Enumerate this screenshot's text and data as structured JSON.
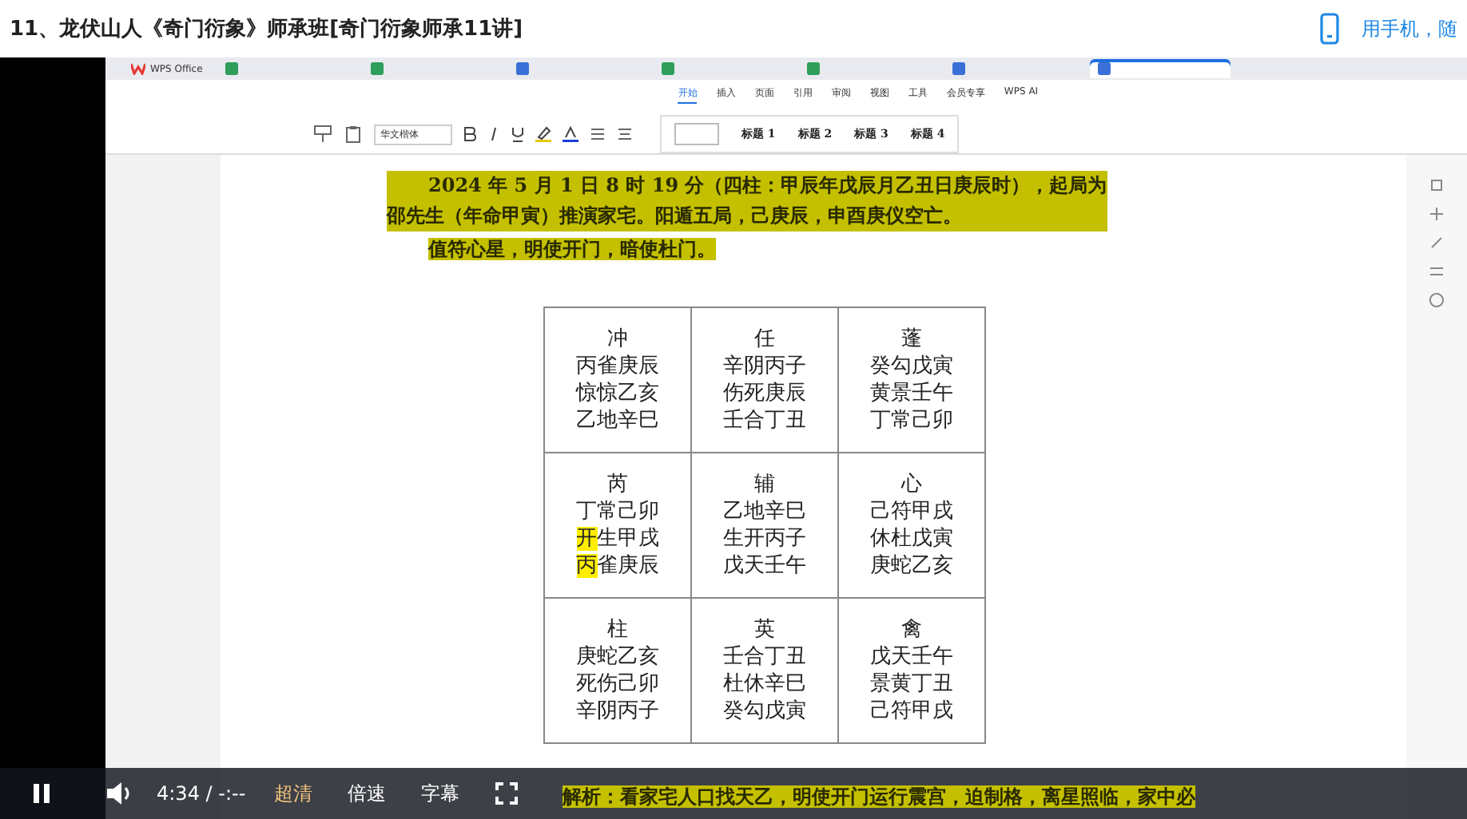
{
  "header": {
    "title": "11、龙伏山人《奇门衍象》师承班[奇门衍象师承11讲]",
    "phone_link": "用手机，随"
  },
  "app": {
    "brand": "WPS Office",
    "doc_tabs": [
      {
        "color": "#2e9e5a",
        "selected": false
      },
      {
        "color": "#2e9e5a",
        "selected": false
      },
      {
        "color": "#3b6fd8",
        "selected": false
      },
      {
        "color": "#2e9e5a",
        "selected": false
      },
      {
        "color": "#2e9e5a",
        "selected": false
      },
      {
        "color": "#3b6fd8",
        "selected": false
      },
      {
        "color": "#3b6fd8",
        "selected": true
      }
    ],
    "menu": [
      {
        "label": "开始",
        "selected": true
      },
      {
        "label": "插入",
        "selected": false
      },
      {
        "label": "页面",
        "selected": false
      },
      {
        "label": "引用",
        "selected": false
      },
      {
        "label": "审阅",
        "selected": false
      },
      {
        "label": "视图",
        "selected": false
      },
      {
        "label": "工具",
        "selected": false
      },
      {
        "label": "会员专享",
        "selected": false
      },
      {
        "label": "WPS AI",
        "selected": false
      }
    ],
    "font_name": "华文楷体",
    "styles": [
      "标题 1",
      "标题 2",
      "标题 3",
      "标题 4"
    ]
  },
  "document": {
    "paragraph": [
      "2024 年 5 月 1 日 8 时 19 分（四柱：甲辰年戊辰月乙丑日庚辰时），起局为",
      "邵先生（年命甲寅）推演家宅。阳遁五局，己庚辰，申酉庚仪空亡。"
    ],
    "paragraph_2": "值符心星，明使开门，暗使杜门。",
    "grid": [
      {
        "star": "冲",
        "lines": [
          {
            "text": "丙雀庚辰"
          },
          {
            "text": "惊惊乙亥"
          },
          {
            "text": "乙地辛巳"
          }
        ]
      },
      {
        "star": "任",
        "lines": [
          {
            "text": "辛阴丙子"
          },
          {
            "text": "伤死庚辰"
          },
          {
            "text": "壬合丁丑"
          }
        ]
      },
      {
        "star": "蓬",
        "lines": [
          {
            "text": "癸勾戊寅"
          },
          {
            "text": "黄景壬午"
          },
          {
            "text": "丁常己卯"
          }
        ]
      },
      {
        "star": "芮",
        "lines": [
          {
            "text": "丁常己卯"
          },
          {
            "highlight": "开",
            "text": "生甲戌"
          },
          {
            "highlight": "丙",
            "text": "雀庚辰"
          }
        ]
      },
      {
        "star": "辅",
        "lines": [
          {
            "text": "乙地辛巳"
          },
          {
            "text": "生开丙子"
          },
          {
            "text": "戊天壬午"
          }
        ]
      },
      {
        "star": "心",
        "lines": [
          {
            "text": "己符甲戌"
          },
          {
            "text": "休杜戊寅"
          },
          {
            "text": "庚蛇乙亥"
          }
        ]
      },
      {
        "star": "柱",
        "lines": [
          {
            "text": "庚蛇乙亥"
          },
          {
            "text": "死伤己卯"
          },
          {
            "text": "辛阴丙子"
          }
        ]
      },
      {
        "star": "英",
        "lines": [
          {
            "text": "壬合丁丑"
          },
          {
            "text": "杜休辛巳"
          },
          {
            "text": "癸勾戊寅"
          }
        ]
      },
      {
        "star": "禽",
        "lines": [
          {
            "text": "戊天壬午"
          },
          {
            "text": "景黄丁丑"
          },
          {
            "text": "己符甲戌"
          }
        ]
      }
    ],
    "analysis": "解析：看家宅人口找天乙，明使开门运行震宫，迫制格，离星照临，家中必"
  },
  "player": {
    "time": "4:34 / -:--",
    "quality": "超清",
    "speed": "倍速",
    "subtitles": "字幕"
  }
}
